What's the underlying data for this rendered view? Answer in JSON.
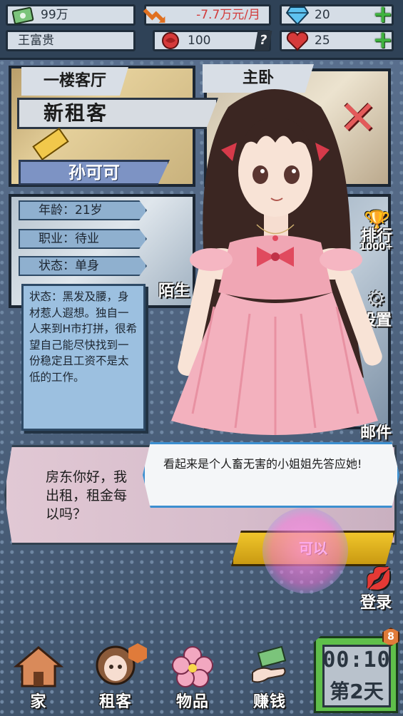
{
  "status_bar": {
    "money": "99万",
    "expense": "-7.7万元/月",
    "gems": "20",
    "player_name": "王富贵",
    "flowers": "100",
    "hearts": "25"
  },
  "rooms": {
    "tab_living": "一楼客厅",
    "tab_master": "主卧",
    "partial_label": "陌生"
  },
  "tenant": {
    "banner": "新租客",
    "name": "孙可可",
    "age": "年龄：21岁",
    "job": "职业：待业",
    "status": "状态：单身",
    "description": "状态：黑发及腰，身材惹人遐想。独自一人来到H市打拼，很希望自己能尽快找到一份稳定且工资不是太低的工作。"
  },
  "side_menu": {
    "rank": "排行",
    "rank_badge": "1000+",
    "settings": "设置",
    "mail": "邮件",
    "login": "登录"
  },
  "dialog": {
    "tenant_text": "房东你好，我\n出租，租金每\n以吗？",
    "bubble_text": "看起来是个人畜无害的小姐姐先答应她!",
    "confirm_button": "可以"
  },
  "bottom_nav": {
    "home": "家",
    "tenant": "租客",
    "items": "物品",
    "earn": "赚钱"
  },
  "clock": {
    "time": "00:10",
    "day": "第2天",
    "badge": "8"
  },
  "colors": {
    "confirm_button": "#e4b520",
    "bubble_border": "#3c8fd0",
    "expense_text": "#d23b3b",
    "plus_icon": "#3fb33f",
    "clock_panel": "#5fbf4a"
  }
}
